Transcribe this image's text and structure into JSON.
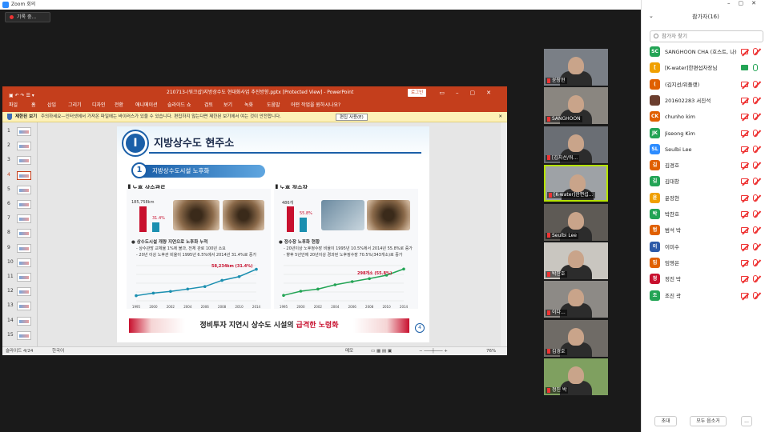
{
  "zoom": {
    "title": "Zoom 회의",
    "recording": "기록 중..."
  },
  "ppt": {
    "title": "210713-(워크샵)지방상수도 현대화사업 추진방향.pptx [Protected View]  -  PowerPoint",
    "login": "로그인",
    "menu": [
      "파일",
      "홈",
      "삽입",
      "그리기",
      "디자인",
      "전환",
      "애니메이션",
      "슬라이드 쇼",
      "검토",
      "보기",
      "녹화",
      "도움말"
    ],
    "tellme": "어떤 작업을 원하시나요?",
    "protected_label": "제한된 보기",
    "protected_msg": "주의하세요—인터넷에서 가져온 파일에는 바이러스가 있을 수 있습니다. 편집하지 않는다면 제한된 보기에서 여는 것이 안전합니다.",
    "enable_edit": "편집 사용(E)",
    "status_slide": "슬라이드 4/24",
    "status_lang": "한국어",
    "status_notes": "메모",
    "zoom_pct": "76%",
    "thumbs": [
      "1",
      "2",
      "3",
      "4",
      "5",
      "6",
      "7",
      "8",
      "9",
      "10",
      "11",
      "12",
      "13",
      "14",
      "15"
    ]
  },
  "slide": {
    "num": "I",
    "title": "지방상수도 현주소",
    "sub_num": "1",
    "subtitle": "지방상수도시설 노후화",
    "left_head": "▌노후 상수관로",
    "right_head": "▌노후 정수장",
    "left_b1": "● 상수도시설 개량 지연으로 노후화 누적",
    "left_b2": "- 상수관망 교체율 1%에 불과, 전체 관로 100년 소요",
    "left_b3": "- 20년 이상 노후관 비율이 1995년 6.5%에서 2014년 31.4%로 증가",
    "right_b1": "● 정수장 노후화 현황",
    "right_b2": "- 20년이상 노후정수장 비율이 1995년 10.5%에서 2014년 55.8%로 증가",
    "right_b3": "- 향후 5년안에 20년이상 경과된 노후정수장 70.5%(343개소)로 증가",
    "left_total": "185,758km",
    "left_pct": "31.4%",
    "right_total": "486개",
    "right_pct": "55.8%",
    "left_callout": "58,234km (31.4%)",
    "right_callout": "298개소 (55.8%)",
    "banner_pre": "정비투자 지연시 상수도 시설의 ",
    "banner_hl": "급격한 노령화",
    "page": "4",
    "years": [
      "1995",
      "2000",
      "2002",
      "2004",
      "2006",
      "2008",
      "2010",
      "2014"
    ]
  },
  "chart_data": [
    {
      "type": "line",
      "x": [
        "1995",
        "2000",
        "2002",
        "2004",
        "2006",
        "2008",
        "2010",
        "2014"
      ],
      "series": [
        {
          "values": [
            9.5,
            14.2,
            17.3,
            21.7,
            26.3,
            37.7,
            44.7,
            58.2
          ]
        }
      ]
    },
    {
      "type": "line",
      "x": [
        "1995",
        "2000",
        "2002",
        "2004",
        "2006",
        "2008",
        "2010",
        "2014"
      ],
      "series": [
        {
          "values": [
            51,
            90,
            110,
            150,
            180,
            208,
            240,
            298
          ]
        }
      ]
    }
  ],
  "videos": [
    {
      "name": "윤장현"
    },
    {
      "name": "SANGHOON"
    },
    {
      "name": "[김지선/워..."
    },
    {
      "name": "[K-water]한편섭..."
    },
    {
      "name": "Seulbi Lee"
    },
    {
      "name": "박찬호"
    },
    {
      "name": "이다..."
    },
    {
      "name": "김경호"
    },
    {
      "name": "정진 박"
    }
  ],
  "panel": {
    "title": "참가자(16)",
    "search": "참가자 찾기",
    "participants": [
      {
        "name": "SANGHOON CHA (호스트, 나)",
        "initial": "SC",
        "color": "#23a455",
        "vid": "off",
        "mic": "off"
      },
      {
        "name": "[K-water]한편섭차장님",
        "initial": "[",
        "color": "#f0a000",
        "vid": "on",
        "mic": "on"
      },
      {
        "name": "(김지선/위플랫)",
        "initial": "(",
        "color": "#e06000",
        "vid": "off",
        "mic": "off"
      },
      {
        "name": "201602283 서진석",
        "initial": "",
        "color": "#6b3e2e",
        "vid": "off",
        "mic": "off"
      },
      {
        "name": "chunho kim",
        "initial": "CK",
        "color": "#e06000",
        "vid": "off",
        "mic": "off"
      },
      {
        "name": "Jiseong Kim",
        "initial": "JK",
        "color": "#23a455",
        "vid": "off",
        "mic": "off"
      },
      {
        "name": "Seulbi Lee",
        "initial": "SL",
        "color": "#2d8cff",
        "vid": "off",
        "mic": "off"
      },
      {
        "name": "김경호",
        "initial": "김",
        "color": "#e06000",
        "vid": "off",
        "mic": "off"
      },
      {
        "name": "김대창",
        "initial": "김",
        "color": "#23a455",
        "vid": "off",
        "mic": "off"
      },
      {
        "name": "윤장현",
        "initial": "윤",
        "color": "#f0a000",
        "vid": "off",
        "mic": "off"
      },
      {
        "name": "박찬호",
        "initial": "박",
        "color": "#23a455",
        "vid": "off",
        "mic": "off"
      },
      {
        "name": "범석 박",
        "initial": "범",
        "color": "#e06000",
        "vid": "off",
        "mic": "off"
      },
      {
        "name": "이미수",
        "initial": "이",
        "color": "#2d5aa8",
        "vid": "off",
        "mic": "off"
      },
      {
        "name": "임영은",
        "initial": "임",
        "color": "#e06000",
        "vid": "off",
        "mic": "off"
      },
      {
        "name": "정진 박",
        "initial": "정",
        "color": "#c8102e",
        "vid": "off",
        "mic": "off"
      },
      {
        "name": "조진 곽",
        "initial": "조",
        "color": "#23a455",
        "vid": "off",
        "mic": "off"
      }
    ],
    "invite": "초대",
    "mute_all": "모두 음소거",
    "more": "..."
  }
}
